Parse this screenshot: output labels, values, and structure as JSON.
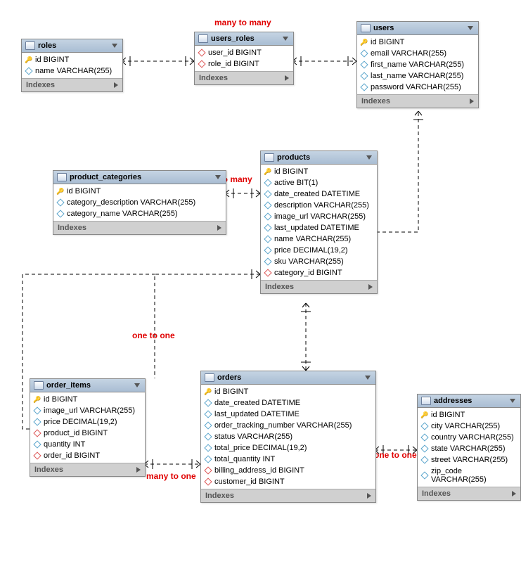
{
  "indexes_label": "Indexes",
  "tables": {
    "roles": {
      "name": "roles",
      "columns": [
        {
          "icon": "key",
          "text": "id BIGINT"
        },
        {
          "icon": "diamond-blue",
          "text": "name VARCHAR(255)"
        }
      ]
    },
    "users_roles": {
      "name": "users_roles",
      "columns": [
        {
          "icon": "diamond-red",
          "text": "user_id BIGINT"
        },
        {
          "icon": "diamond-red",
          "text": "role_id BIGINT"
        }
      ]
    },
    "users": {
      "name": "users",
      "columns": [
        {
          "icon": "key",
          "text": "id BIGINT"
        },
        {
          "icon": "diamond-blue",
          "text": "email VARCHAR(255)"
        },
        {
          "icon": "diamond-blue",
          "text": "first_name VARCHAR(255)"
        },
        {
          "icon": "diamond-blue",
          "text": "last_name VARCHAR(255)"
        },
        {
          "icon": "diamond-blue",
          "text": "password VARCHAR(255)"
        }
      ]
    },
    "product_categories": {
      "name": "product_categories",
      "columns": [
        {
          "icon": "key",
          "text": "id BIGINT"
        },
        {
          "icon": "diamond-blue",
          "text": "category_description VARCHAR(255)"
        },
        {
          "icon": "diamond-blue",
          "text": "category_name VARCHAR(255)"
        }
      ]
    },
    "products": {
      "name": "products",
      "columns": [
        {
          "icon": "key",
          "text": "id BIGINT"
        },
        {
          "icon": "diamond-blue",
          "text": "active BIT(1)"
        },
        {
          "icon": "diamond-blue",
          "text": "date_created DATETIME"
        },
        {
          "icon": "diamond-blue",
          "text": "description VARCHAR(255)"
        },
        {
          "icon": "diamond-blue",
          "text": "image_url VARCHAR(255)"
        },
        {
          "icon": "diamond-blue",
          "text": "last_updated DATETIME"
        },
        {
          "icon": "diamond-blue",
          "text": "name VARCHAR(255)"
        },
        {
          "icon": "diamond-blue",
          "text": "price DECIMAL(19,2)"
        },
        {
          "icon": "diamond-blue",
          "text": "sku VARCHAR(255)"
        },
        {
          "icon": "diamond-red",
          "text": "category_id BIGINT"
        }
      ]
    },
    "order_items": {
      "name": "order_items",
      "columns": [
        {
          "icon": "key",
          "text": "id BIGINT"
        },
        {
          "icon": "diamond-blue",
          "text": "image_url VARCHAR(255)"
        },
        {
          "icon": "diamond-blue",
          "text": "price DECIMAL(19,2)"
        },
        {
          "icon": "diamond-red",
          "text": "product_id BIGINT"
        },
        {
          "icon": "diamond-blue",
          "text": "quantity INT"
        },
        {
          "icon": "diamond-red",
          "text": "order_id BIGINT"
        }
      ]
    },
    "orders": {
      "name": "orders",
      "columns": [
        {
          "icon": "key",
          "text": "id BIGINT"
        },
        {
          "icon": "diamond-blue",
          "text": "date_created DATETIME"
        },
        {
          "icon": "diamond-blue",
          "text": "last_updated DATETIME"
        },
        {
          "icon": "diamond-blue",
          "text": "order_tracking_number VARCHAR(255)"
        },
        {
          "icon": "diamond-blue",
          "text": "status VARCHAR(255)"
        },
        {
          "icon": "diamond-blue",
          "text": "total_price DECIMAL(19,2)"
        },
        {
          "icon": "diamond-blue",
          "text": "total_quantity INT"
        },
        {
          "icon": "diamond-red",
          "text": "billing_address_id BIGINT"
        },
        {
          "icon": "diamond-red",
          "text": "customer_id BIGINT"
        }
      ]
    },
    "addresses": {
      "name": "addresses",
      "columns": [
        {
          "icon": "key",
          "text": "id BIGINT"
        },
        {
          "icon": "diamond-blue",
          "text": "city VARCHAR(255)"
        },
        {
          "icon": "diamond-blue",
          "text": "country VARCHAR(255)"
        },
        {
          "icon": "diamond-blue",
          "text": "state VARCHAR(255)"
        },
        {
          "icon": "diamond-blue",
          "text": "street VARCHAR(255)"
        },
        {
          "icon": "diamond-blue",
          "text": "zip_code VARCHAR(255)"
        }
      ]
    }
  },
  "labels": {
    "many_to_many": "many to many",
    "one_to_many": "one to many",
    "one_to_one_1": "one to one",
    "many_to_one": "many to one",
    "one_to_one_2": "one to one"
  },
  "chart_data": {
    "type": "er-diagram",
    "entities": [
      {
        "name": "roles",
        "pk": [
          "id"
        ],
        "columns": [
          "id BIGINT",
          "name VARCHAR(255)"
        ]
      },
      {
        "name": "users_roles",
        "pk": [],
        "columns": [
          "user_id BIGINT",
          "role_id BIGINT"
        ]
      },
      {
        "name": "users",
        "pk": [
          "id"
        ],
        "columns": [
          "id BIGINT",
          "email VARCHAR(255)",
          "first_name VARCHAR(255)",
          "last_name VARCHAR(255)",
          "password VARCHAR(255)"
        ]
      },
      {
        "name": "product_categories",
        "pk": [
          "id"
        ],
        "columns": [
          "id BIGINT",
          "category_description VARCHAR(255)",
          "category_name VARCHAR(255)"
        ]
      },
      {
        "name": "products",
        "pk": [
          "id"
        ],
        "columns": [
          "id BIGINT",
          "active BIT(1)",
          "date_created DATETIME",
          "description VARCHAR(255)",
          "image_url VARCHAR(255)",
          "last_updated DATETIME",
          "name VARCHAR(255)",
          "price DECIMAL(19,2)",
          "sku VARCHAR(255)",
          "category_id BIGINT"
        ]
      },
      {
        "name": "order_items",
        "pk": [
          "id"
        ],
        "columns": [
          "id BIGINT",
          "image_url VARCHAR(255)",
          "price DECIMAL(19,2)",
          "product_id BIGINT",
          "quantity INT",
          "order_id BIGINT"
        ]
      },
      {
        "name": "orders",
        "pk": [
          "id"
        ],
        "columns": [
          "id BIGINT",
          "date_created DATETIME",
          "last_updated DATETIME",
          "order_tracking_number VARCHAR(255)",
          "status VARCHAR(255)",
          "total_price DECIMAL(19,2)",
          "total_quantity INT",
          "billing_address_id BIGINT",
          "customer_id BIGINT"
        ]
      },
      {
        "name": "addresses",
        "pk": [
          "id"
        ],
        "columns": [
          "id BIGINT",
          "city VARCHAR(255)",
          "country VARCHAR(255)",
          "state VARCHAR(255)",
          "street VARCHAR(255)",
          "zip_code VARCHAR(255)"
        ]
      }
    ],
    "relationships": [
      {
        "from": "roles",
        "to": "users_roles",
        "type": "many-to-many"
      },
      {
        "from": "users_roles",
        "to": "users",
        "type": "many-to-many"
      },
      {
        "from": "product_categories",
        "to": "products",
        "type": "one-to-many"
      },
      {
        "from": "products",
        "to": "order_items",
        "type": "one-to-one"
      },
      {
        "from": "order_items",
        "to": "orders",
        "type": "many-to-one"
      },
      {
        "from": "orders",
        "to": "addresses",
        "type": "one-to-one"
      },
      {
        "from": "orders",
        "to": "users",
        "type": "many-to-one"
      },
      {
        "from": "orders",
        "to": "products",
        "type": "one-to-many"
      }
    ]
  }
}
